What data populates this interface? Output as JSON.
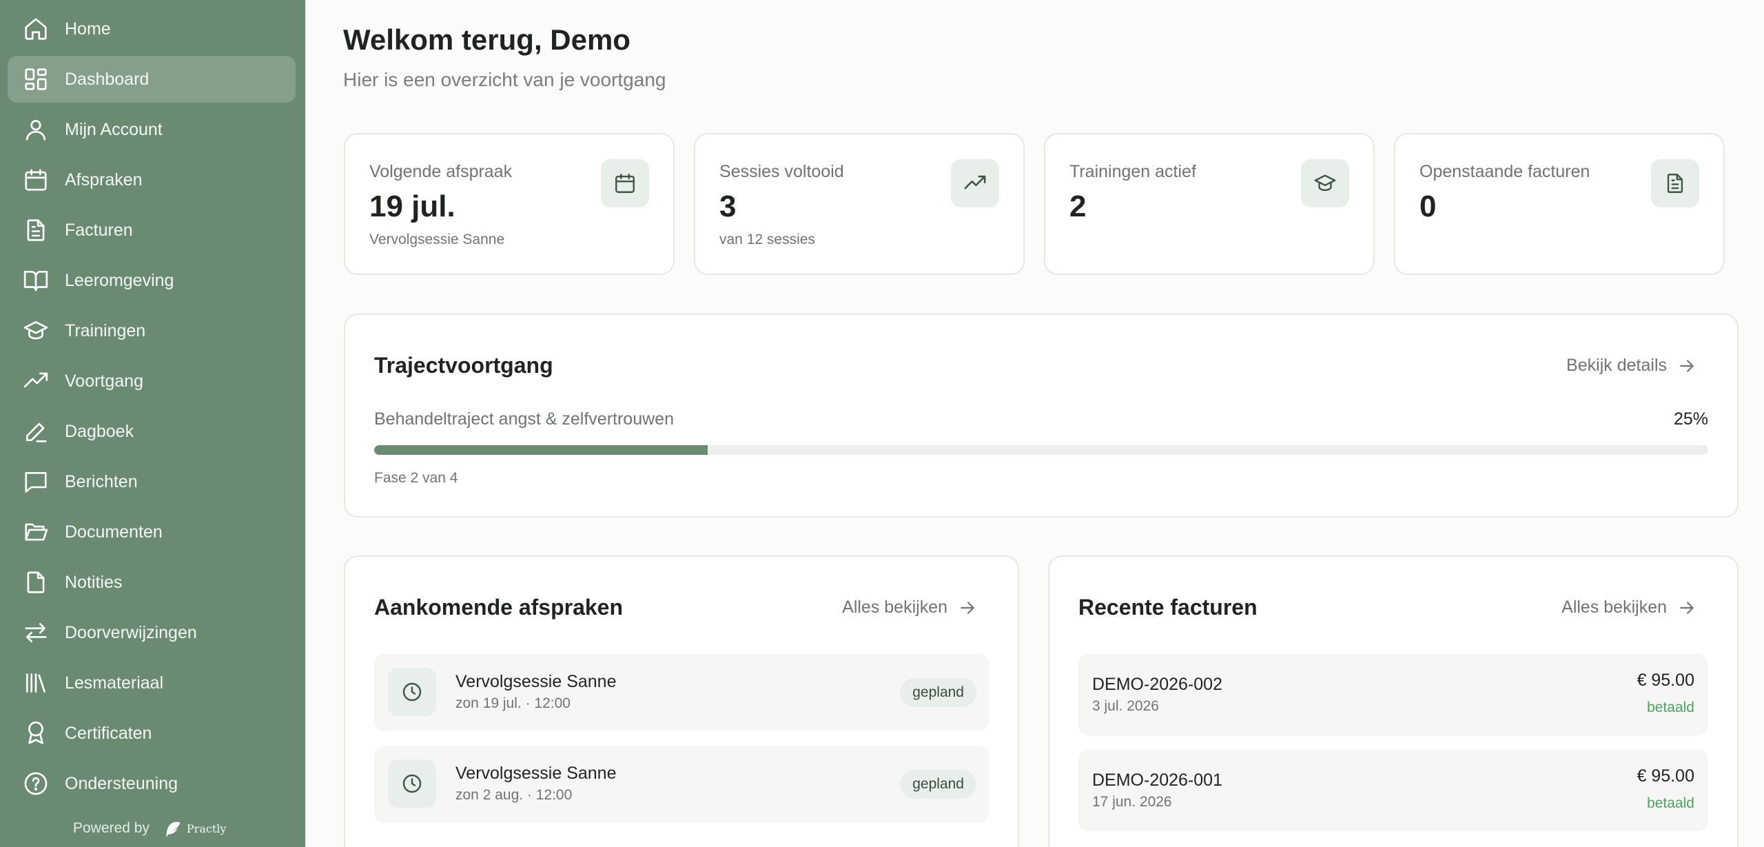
{
  "sidebar": {
    "items": [
      {
        "label": "Home",
        "icon": "home-icon"
      },
      {
        "label": "Dashboard",
        "icon": "dashboard-icon",
        "active": true
      },
      {
        "label": "Mijn Account",
        "icon": "user-icon"
      },
      {
        "label": "Afspraken",
        "icon": "calendar-icon"
      },
      {
        "label": "Facturen",
        "icon": "file-text-icon"
      },
      {
        "label": "Leeromgeving",
        "icon": "book-open-icon"
      },
      {
        "label": "Trainingen",
        "icon": "graduation-cap-icon"
      },
      {
        "label": "Voortgang",
        "icon": "trending-up-icon"
      },
      {
        "label": "Dagboek",
        "icon": "pencil-icon"
      },
      {
        "label": "Berichten",
        "icon": "message-square-icon"
      },
      {
        "label": "Documenten",
        "icon": "folder-open-icon"
      },
      {
        "label": "Notities",
        "icon": "file-icon"
      },
      {
        "label": "Doorverwijzingen",
        "icon": "arrows-exchange-icon"
      },
      {
        "label": "Lesmateriaal",
        "icon": "library-icon"
      },
      {
        "label": "Certificaten",
        "icon": "award-icon"
      },
      {
        "label": "Ondersteuning",
        "icon": "help-circle-icon"
      }
    ],
    "powered_by": "Powered by",
    "brand": "Practly"
  },
  "header": {
    "title": "Welkom terug, Demo",
    "subtitle": "Hier is een overzicht van je voortgang"
  },
  "stats": [
    {
      "label": "Volgende afspraak",
      "value": "19 jul.",
      "sub": "Vervolgsessie Sanne",
      "icon": "calendar-icon"
    },
    {
      "label": "Sessies voltooid",
      "value": "3",
      "sub": "van 12 sessies",
      "icon": "trending-up-icon"
    },
    {
      "label": "Trainingen actief",
      "value": "2",
      "sub": "",
      "icon": "graduation-cap-icon"
    },
    {
      "label": "Openstaande facturen",
      "value": "0",
      "sub": "",
      "icon": "file-text-icon"
    }
  ],
  "trajectory": {
    "title": "Trajectvoortgang",
    "link": "Bekijk details",
    "name": "Behandeltraject angst & zelfvertrouwen",
    "percent_label": "25%",
    "progress": 0.25,
    "phase": "Fase 2 van 4"
  },
  "appointments": {
    "title": "Aankomende afspraken",
    "link": "Alles bekijken",
    "items": [
      {
        "name": "Vervolgsessie Sanne",
        "when": "zon 19 jul. · 12:00",
        "status": "gepland"
      },
      {
        "name": "Vervolgsessie Sanne",
        "when": "zon 2 aug. · 12:00",
        "status": "gepland"
      }
    ]
  },
  "invoices": {
    "title": "Recente facturen",
    "link": "Alles bekijken",
    "items": [
      {
        "number": "DEMO-2026-002",
        "date": "3 jul. 2026",
        "amount": "€ 95.00",
        "status": "betaald"
      },
      {
        "number": "DEMO-2026-001",
        "date": "17 jun. 2026",
        "amount": "€ 95.00",
        "status": "betaald"
      }
    ]
  },
  "colors": {
    "sidebar": "#6b8a72",
    "accent": "#6b8a72",
    "paid": "#4fa062"
  }
}
